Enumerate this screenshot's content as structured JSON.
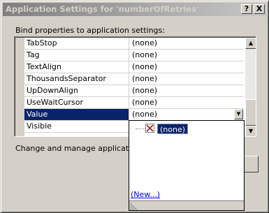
{
  "window": {
    "title": "Application Settings for 'numberOfRetries'",
    "help_label": "?",
    "close_label": "X"
  },
  "bind_label": "Bind properties to application settings:",
  "grid": {
    "rows": [
      {
        "name": "TabStop",
        "value": "(none)"
      },
      {
        "name": "Tag",
        "value": "(none)"
      },
      {
        "name": "TextAlign",
        "value": "(none)"
      },
      {
        "name": "ThousandsSeparator",
        "value": "(none)"
      },
      {
        "name": "UpDownAlign",
        "value": "(none)"
      },
      {
        "name": "UseWaitCursor",
        "value": "(none)"
      },
      {
        "name": "Value",
        "value": "(none)",
        "selected": true
      },
      {
        "name": "Visible",
        "value": ""
      }
    ],
    "dropdown_arrow": "▼"
  },
  "scrollbar": {
    "up_arrow": "▲",
    "down_arrow": "▼"
  },
  "description": "Change and manage application se",
  "popup": {
    "none_item": "(none)",
    "new_link": "(New...)"
  },
  "icons": {
    "none_item_icon": "red-x-icon",
    "dropdown_icon": "chevron-down-icon",
    "grip_icon": "resize-grip-icon"
  },
  "colors": {
    "selection": "#0a246a",
    "face": "#d4d0c8",
    "link": "#0000ff",
    "x_icon": "#a00000"
  }
}
